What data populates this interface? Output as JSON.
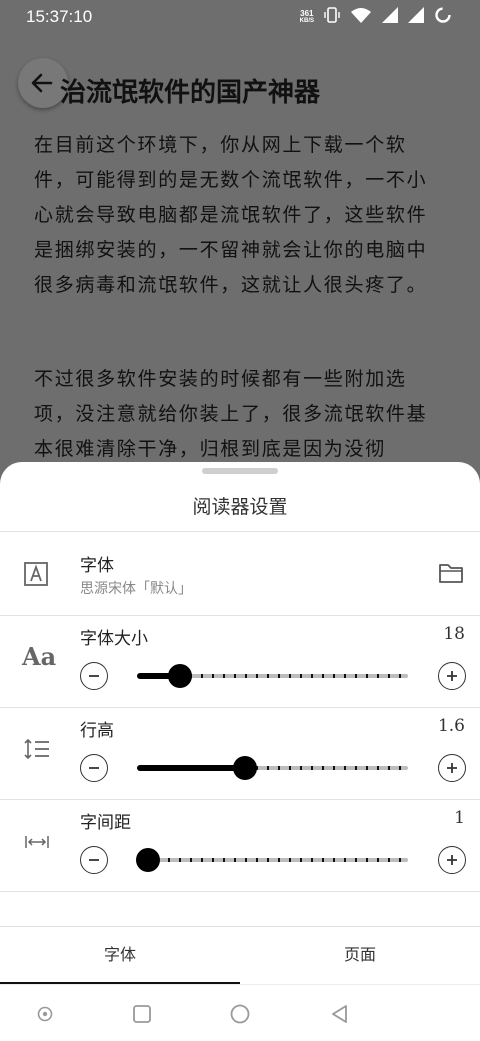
{
  "status_bar": {
    "time": "15:37:10",
    "net_speed_value": "361",
    "net_speed_unit": "KB/S"
  },
  "article": {
    "title": "治流氓软件的国产神器",
    "paragraphs": [
      "在目前这个环境下，你从网上下载一个软件，可能得到的是无数个流氓软件，一不小心就会导致电脑都是流氓软件了，这些软件是捆绑安装的，一不留神就会让你的电脑中很多病毒和流氓软件，这就让人很头疼了。",
      "不过很多软件安装的时候都有一些附加选项，没注意就给你装上了，很多流氓软件基本很难清除干净，归根到底是因为没彻"
    ]
  },
  "sheet": {
    "title": "阅读器设置",
    "font": {
      "label": "字体",
      "value": "思源宋体「默认」"
    },
    "font_size": {
      "label": "字体大小",
      "value": "18",
      "fraction": 0.16
    },
    "line_height": {
      "label": "行高",
      "value": "1.6",
      "fraction": 0.4
    },
    "letter_spacing": {
      "label": "字间距",
      "value": "1",
      "fraction": 0.04
    },
    "tabs": [
      {
        "label": "字体",
        "active": true
      },
      {
        "label": "页面",
        "active": false
      }
    ]
  },
  "icons": [
    "back-arrow-icon",
    "font-icon",
    "folder-icon",
    "font-size-icon",
    "line-height-icon",
    "letter-spacing-icon",
    "minus-icon",
    "plus-icon",
    "nav-dot-icon",
    "nav-recents-icon",
    "nav-home-icon",
    "nav-back-icon"
  ],
  "colors": {
    "accent": "#000000",
    "overlay": "#6e6e6e",
    "track": "#bdbdbd"
  }
}
